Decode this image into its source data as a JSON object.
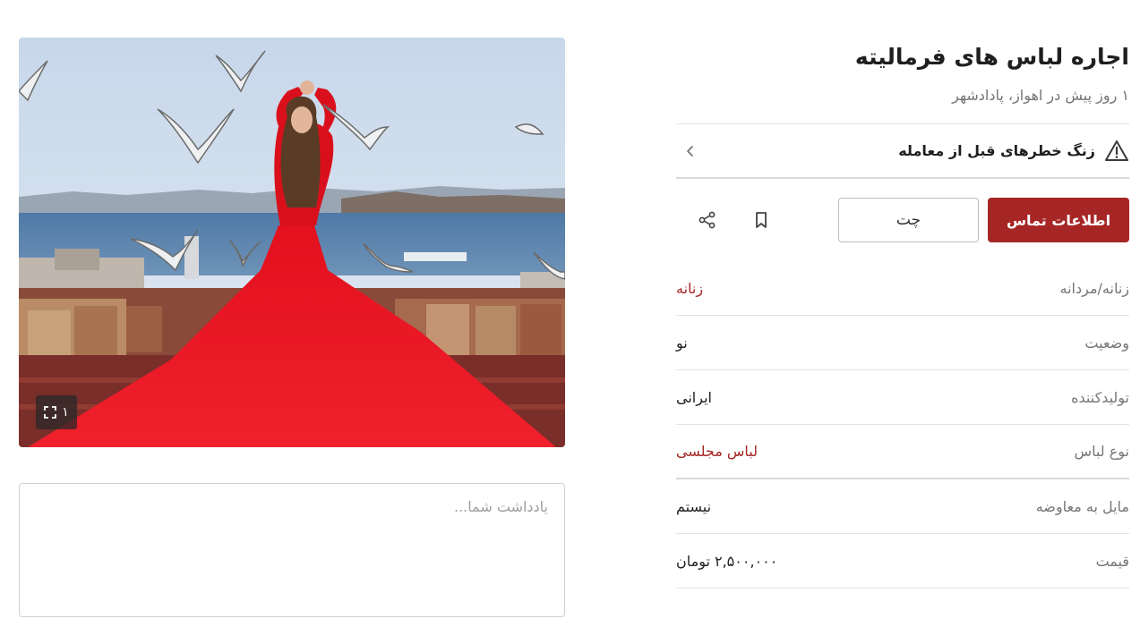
{
  "listing": {
    "title": "اجاره لباس های فرمالیته",
    "subtitle": "۱ روز پیش در اهواز، پادادشهر"
  },
  "warning": {
    "text": "زنگ خطرهای قبل از معامله",
    "icon": "warning-triangle-icon"
  },
  "actions": {
    "contact_label": "اطلاعات تماس",
    "chat_label": "چت",
    "bookmark_icon": "bookmark-icon",
    "share_icon": "share-icon"
  },
  "attributes": [
    {
      "label": "زنانه/مردانه",
      "value": "زنانه"
    },
    {
      "label": "وضعیت",
      "value": "نو"
    },
    {
      "label": "تولیدکننده",
      "value": "ایرانی"
    },
    {
      "label": "نوع لباس",
      "value": "لباس مجلسی"
    },
    {
      "label": "مایل به معاوضه",
      "value": "نیستم"
    },
    {
      "label": "قیمت",
      "value": "۲,۵۰۰,۰۰۰ تومان"
    }
  ],
  "gallery": {
    "image_count": "۱",
    "expand_icon": "expand-icon"
  },
  "note": {
    "placeholder": "یادداشت شما..."
  },
  "colors": {
    "accent": "#a62626",
    "text": "#1f1f1f",
    "muted": "#757575",
    "divider": "#e3e3e3"
  }
}
